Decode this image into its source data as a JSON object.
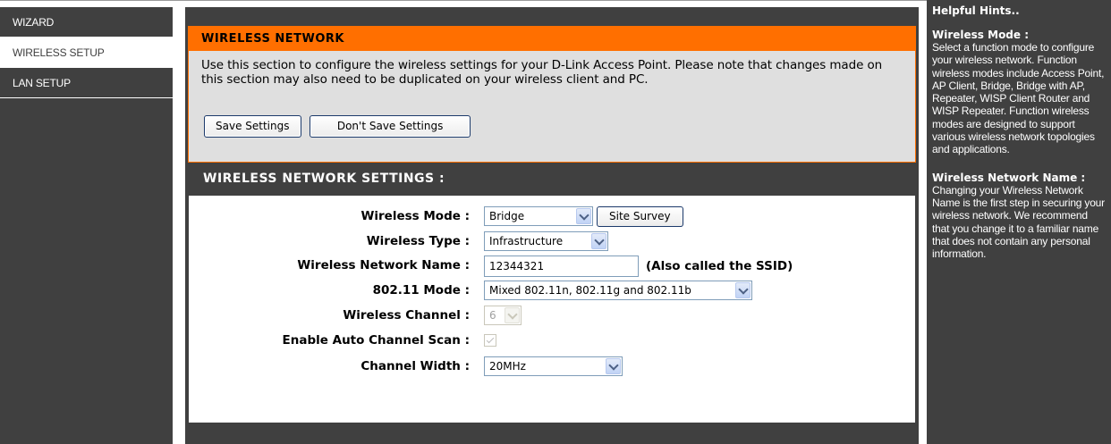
{
  "nav": {
    "items": [
      {
        "label": "WIZARD"
      },
      {
        "label": "WIRELESS SETUP"
      },
      {
        "label": "LAN SETUP"
      }
    ],
    "active": "WIRELESS SETUP"
  },
  "wireless_network": {
    "title": "WIRELESS NETWORK",
    "description": "Use this section to configure the wireless settings for your D-Link Access Point. Please note that changes made on this section may also need to be duplicated on your wireless client and PC.",
    "save_label": "Save Settings",
    "dont_save_label": "Don't Save Settings"
  },
  "settings": {
    "title": "WIRELESS NETWORK SETTINGS :",
    "wireless_mode": {
      "label": "Wireless Mode :",
      "value": "Bridge",
      "site_survey_label": "Site Survey"
    },
    "wireless_type": {
      "label": "Wireless Type :",
      "value": "Infrastructure"
    },
    "network_name": {
      "label": "Wireless Network Name :",
      "value": "12344321",
      "hint": "(Also called the SSID)"
    },
    "mode_80211": {
      "label": "802.11 Mode :",
      "value": "Mixed 802.11n, 802.11g and 802.11b"
    },
    "channel": {
      "label": "Wireless Channel :",
      "value": "6",
      "disabled": true
    },
    "auto_channel": {
      "label": "Enable Auto Channel Scan :",
      "checked": true,
      "disabled": true
    },
    "channel_width": {
      "label": "Channel Width :",
      "value": "20MHz"
    }
  },
  "hints": {
    "title": "Helpful Hints..",
    "items": [
      {
        "heading": "Wireless Mode :",
        "text": "Select a function mode to configure your wireless network. Function wireless modes include Access Point, AP Client, Bridge, Bridge with AP, Repeater, WISP Client Router and WISP Repeater. Function wireless modes are designed to support various wireless network topologies and applications."
      },
      {
        "heading": "Wireless Network Name :",
        "text": "Changing your Wireless Network Name is the first step in securing your wireless network. We recommend that you change it to a familiar name that does not contain any personal information."
      }
    ]
  }
}
